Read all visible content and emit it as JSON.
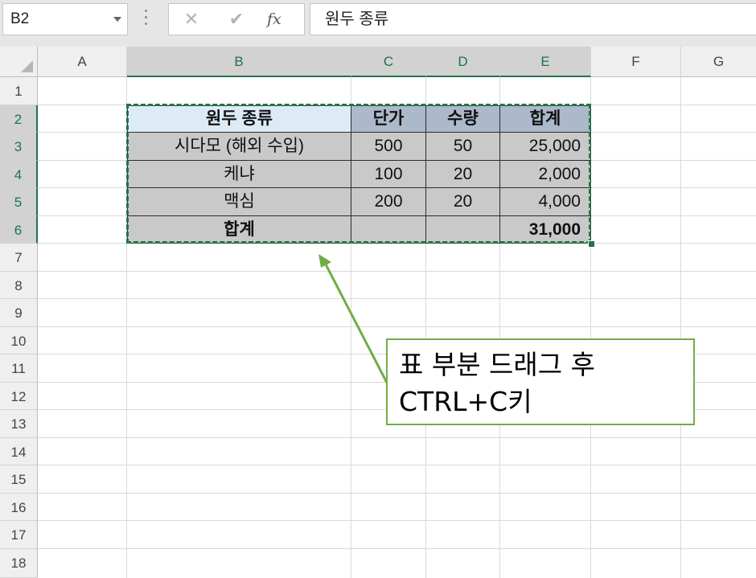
{
  "formula_bar": {
    "name_box": "B2",
    "cancel_symbol": "✕",
    "enter_symbol": "✔",
    "fx_label": "fx",
    "content": "원두 종류"
  },
  "columns": [
    "A",
    "B",
    "C",
    "D",
    "E",
    "F",
    "G"
  ],
  "rows": [
    "1",
    "2",
    "3",
    "4",
    "5",
    "6",
    "7",
    "8",
    "9",
    "10",
    "11",
    "12",
    "13",
    "14",
    "15",
    "16",
    "17",
    "18"
  ],
  "table": {
    "header": [
      "원두 종류",
      "단가",
      "수량",
      "합계"
    ],
    "rows": [
      [
        "시다모 (해외 수입)",
        "500",
        "50",
        "25,000"
      ],
      [
        "케냐",
        "100",
        "20",
        "2,000"
      ],
      [
        "맥심",
        "200",
        "20",
        "4,000"
      ]
    ],
    "total": [
      "합계",
      "",
      "",
      "31,000"
    ]
  },
  "callout": {
    "line1": "표 부분 드래그 후",
    "line2": "CTRL+C키"
  },
  "colors": {
    "excel_green": "#217346",
    "callout_border": "#70ad47",
    "header_blue": "#ddebf7",
    "header_gray_blue": "#acb9ca",
    "body_gray": "#c9c9c9"
  }
}
